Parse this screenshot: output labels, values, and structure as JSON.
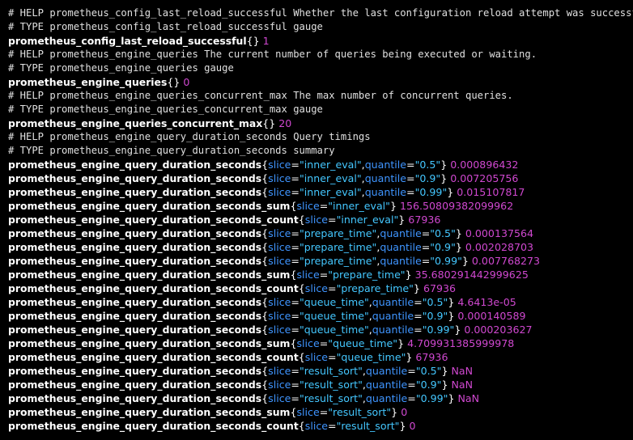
{
  "colors": {
    "background": "#000000",
    "comment_text": "#e0e0e0",
    "metric_name": "#ffffff",
    "label_key": "#3f95ff",
    "label_value": "#44c7ff",
    "sample_value": "#d048d0"
  },
  "lines": [
    {
      "type": "comment",
      "text": "# HELP prometheus_config_last_reload_successful Whether the last configuration reload attempt was successful."
    },
    {
      "type": "comment",
      "text": "# TYPE prometheus_config_last_reload_successful gauge"
    },
    {
      "type": "metric",
      "name": "prometheus_config_last_reload_successful",
      "labels": [],
      "value": "1"
    },
    {
      "type": "comment",
      "text": "# HELP prometheus_engine_queries The current number of queries being executed or waiting."
    },
    {
      "type": "comment",
      "text": "# TYPE prometheus_engine_queries gauge"
    },
    {
      "type": "metric",
      "name": "prometheus_engine_queries",
      "labels": [],
      "value": "0"
    },
    {
      "type": "comment",
      "text": "# HELP prometheus_engine_queries_concurrent_max The max number of concurrent queries."
    },
    {
      "type": "comment",
      "text": "# TYPE prometheus_engine_queries_concurrent_max gauge"
    },
    {
      "type": "metric",
      "name": "prometheus_engine_queries_concurrent_max",
      "labels": [],
      "value": "20"
    },
    {
      "type": "comment",
      "text": "# HELP prometheus_engine_query_duration_seconds Query timings"
    },
    {
      "type": "comment",
      "text": "# TYPE prometheus_engine_query_duration_seconds summary"
    },
    {
      "type": "metric",
      "name": "prometheus_engine_query_duration_seconds",
      "labels": [
        {
          "key": "slice",
          "val": "\"inner_eval\""
        },
        {
          "key": "quantile",
          "val": "\"0.5\""
        }
      ],
      "value": "0.000896432"
    },
    {
      "type": "metric",
      "name": "prometheus_engine_query_duration_seconds",
      "labels": [
        {
          "key": "slice",
          "val": "\"inner_eval\""
        },
        {
          "key": "quantile",
          "val": "\"0.9\""
        }
      ],
      "value": "0.007205756"
    },
    {
      "type": "metric",
      "name": "prometheus_engine_query_duration_seconds",
      "labels": [
        {
          "key": "slice",
          "val": "\"inner_eval\""
        },
        {
          "key": "quantile",
          "val": "\"0.99\""
        }
      ],
      "value": "0.015107817"
    },
    {
      "type": "metric",
      "name": "prometheus_engine_query_duration_seconds_sum",
      "labels": [
        {
          "key": "slice",
          "val": "\"inner_eval\""
        }
      ],
      "value": "156.50809382099962"
    },
    {
      "type": "metric",
      "name": "prometheus_engine_query_duration_seconds_count",
      "labels": [
        {
          "key": "slice",
          "val": "\"inner_eval\""
        }
      ],
      "value": "67936"
    },
    {
      "type": "metric",
      "name": "prometheus_engine_query_duration_seconds",
      "labels": [
        {
          "key": "slice",
          "val": "\"prepare_time\""
        },
        {
          "key": "quantile",
          "val": "\"0.5\""
        }
      ],
      "value": "0.000137564"
    },
    {
      "type": "metric",
      "name": "prometheus_engine_query_duration_seconds",
      "labels": [
        {
          "key": "slice",
          "val": "\"prepare_time\""
        },
        {
          "key": "quantile",
          "val": "\"0.9\""
        }
      ],
      "value": "0.002028703"
    },
    {
      "type": "metric",
      "name": "prometheus_engine_query_duration_seconds",
      "labels": [
        {
          "key": "slice",
          "val": "\"prepare_time\""
        },
        {
          "key": "quantile",
          "val": "\"0.99\""
        }
      ],
      "value": "0.007768273"
    },
    {
      "type": "metric",
      "name": "prometheus_engine_query_duration_seconds_sum",
      "labels": [
        {
          "key": "slice",
          "val": "\"prepare_time\""
        }
      ],
      "value": "35.680291442999625"
    },
    {
      "type": "metric",
      "name": "prometheus_engine_query_duration_seconds_count",
      "labels": [
        {
          "key": "slice",
          "val": "\"prepare_time\""
        }
      ],
      "value": "67936"
    },
    {
      "type": "metric",
      "name": "prometheus_engine_query_duration_seconds",
      "labels": [
        {
          "key": "slice",
          "val": "\"queue_time\""
        },
        {
          "key": "quantile",
          "val": "\"0.5\""
        }
      ],
      "value": "4.6413e-05"
    },
    {
      "type": "metric",
      "name": "prometheus_engine_query_duration_seconds",
      "labels": [
        {
          "key": "slice",
          "val": "\"queue_time\""
        },
        {
          "key": "quantile",
          "val": "\"0.9\""
        }
      ],
      "value": "0.000140589"
    },
    {
      "type": "metric",
      "name": "prometheus_engine_query_duration_seconds",
      "labels": [
        {
          "key": "slice",
          "val": "\"queue_time\""
        },
        {
          "key": "quantile",
          "val": "\"0.99\""
        }
      ],
      "value": "0.000203627"
    },
    {
      "type": "metric",
      "name": "prometheus_engine_query_duration_seconds_sum",
      "labels": [
        {
          "key": "slice",
          "val": "\"queue_time\""
        }
      ],
      "value": "4.709931385999978"
    },
    {
      "type": "metric",
      "name": "prometheus_engine_query_duration_seconds_count",
      "labels": [
        {
          "key": "slice",
          "val": "\"queue_time\""
        }
      ],
      "value": "67936"
    },
    {
      "type": "metric",
      "name": "prometheus_engine_query_duration_seconds",
      "labels": [
        {
          "key": "slice",
          "val": "\"result_sort\""
        },
        {
          "key": "quantile",
          "val": "\"0.5\""
        }
      ],
      "value": "NaN"
    },
    {
      "type": "metric",
      "name": "prometheus_engine_query_duration_seconds",
      "labels": [
        {
          "key": "slice",
          "val": "\"result_sort\""
        },
        {
          "key": "quantile",
          "val": "\"0.9\""
        }
      ],
      "value": "NaN"
    },
    {
      "type": "metric",
      "name": "prometheus_engine_query_duration_seconds",
      "labels": [
        {
          "key": "slice",
          "val": "\"result_sort\""
        },
        {
          "key": "quantile",
          "val": "\"0.99\""
        }
      ],
      "value": "NaN"
    },
    {
      "type": "metric",
      "name": "prometheus_engine_query_duration_seconds_sum",
      "labels": [
        {
          "key": "slice",
          "val": "\"result_sort\""
        }
      ],
      "value": "0"
    },
    {
      "type": "metric",
      "name": "prometheus_engine_query_duration_seconds_count",
      "labels": [
        {
          "key": "slice",
          "val": "\"result_sort\""
        }
      ],
      "value": "0"
    }
  ]
}
